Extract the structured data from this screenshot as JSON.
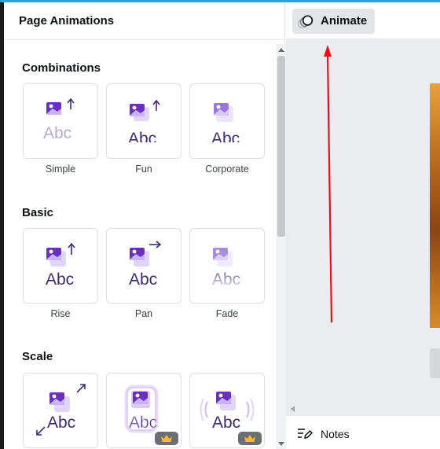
{
  "panel": {
    "title": "Page Animations"
  },
  "sections": [
    {
      "title": "Combinations",
      "items": [
        {
          "label": "Simple",
          "icon": "animation-simple-icon",
          "premium": false
        },
        {
          "label": "Fun",
          "icon": "animation-fun-icon",
          "premium": false
        },
        {
          "label": "Corporate",
          "icon": "animation-corporate-icon",
          "premium": false
        }
      ]
    },
    {
      "title": "Basic",
      "items": [
        {
          "label": "Rise",
          "icon": "animation-rise-icon",
          "premium": false
        },
        {
          "label": "Pan",
          "icon": "animation-pan-icon",
          "premium": false
        },
        {
          "label": "Fade",
          "icon": "animation-fade-icon",
          "premium": false
        }
      ]
    },
    {
      "title": "Scale",
      "items": [
        {
          "label": "",
          "icon": "animation-scale-icon",
          "premium": false
        },
        {
          "label": "",
          "icon": "animation-pulse-icon",
          "premium": true
        },
        {
          "label": "",
          "icon": "animation-wiggle-icon",
          "premium": true
        }
      ]
    }
  ],
  "preview_text": "Abc",
  "toolbar": {
    "animate_label": "Animate"
  },
  "notes": {
    "label": "Notes"
  },
  "colors": {
    "accent_purple": "#6b2fbf",
    "light_purple": "#c9b3f0",
    "text_purple": "#3f2a70",
    "annotation_red": "#e8101a",
    "crown_gold": "#f5b731"
  }
}
